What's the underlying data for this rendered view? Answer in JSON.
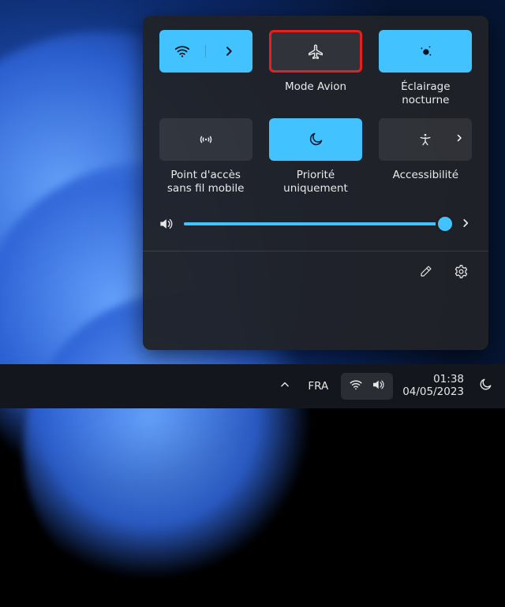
{
  "tiles": {
    "wifi": {
      "label": "",
      "active": true
    },
    "airplane": {
      "label": "Mode Avion",
      "active": false
    },
    "nightlight": {
      "label": "Éclairage nocturne",
      "active": true
    },
    "hotspot": {
      "label": "Point d'accès sans fil mobile",
      "active": false
    },
    "focus": {
      "label": "Priorité uniquement",
      "active": true
    },
    "access": {
      "label": "Accessibilité",
      "active": false
    }
  },
  "volume": {
    "percent": 99
  },
  "taskbar": {
    "lang": "FRA",
    "time": "01:38",
    "date": "04/05/2023"
  }
}
